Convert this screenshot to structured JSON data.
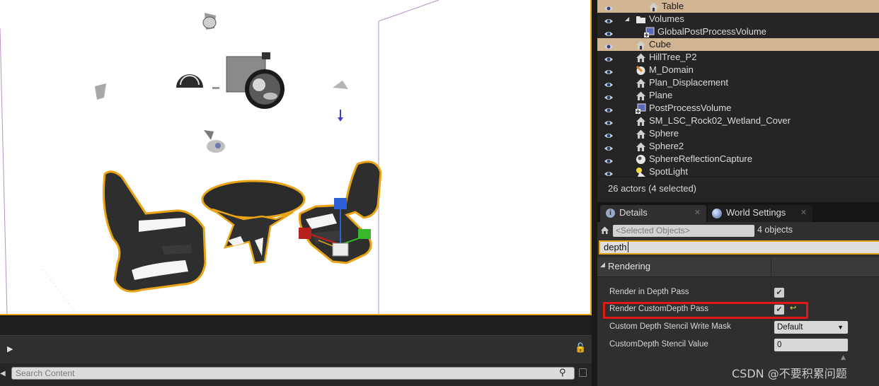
{
  "outliner": {
    "rows": [
      {
        "label": "Table",
        "icon": "house-icon",
        "selected": true
      },
      {
        "label": "Volumes",
        "icon": "folder-icon",
        "selected": false,
        "expander": true
      },
      {
        "label": "GlobalPostProcessVolume",
        "icon": "postprocess-volume-icon",
        "selected": false
      },
      {
        "label": "Cube",
        "icon": "house-icon",
        "selected": true
      },
      {
        "label": "HillTree_P2",
        "icon": "house-icon",
        "selected": false
      },
      {
        "label": "M_Domain",
        "icon": "material-icon",
        "selected": false
      },
      {
        "label": "Plan_Displacement",
        "icon": "house-icon",
        "selected": false
      },
      {
        "label": "Plane",
        "icon": "house-icon",
        "selected": false
      },
      {
        "label": "PostProcessVolume",
        "icon": "postprocess-volume-icon",
        "selected": false
      },
      {
        "label": "SM_LSC_Rock02_Wetland_Cover",
        "icon": "house-icon",
        "selected": false
      },
      {
        "label": "Sphere",
        "icon": "house-icon",
        "selected": false
      },
      {
        "label": "Sphere2",
        "icon": "house-icon",
        "selected": false
      },
      {
        "label": "SphereReflectionCapture",
        "icon": "reflection-capture-icon",
        "selected": false
      },
      {
        "label": "SpotLight",
        "icon": "spotlight-icon",
        "selected": false
      }
    ],
    "footer": "26 actors (4 selected)"
  },
  "tabs": {
    "details": "Details",
    "world_settings": "World Settings"
  },
  "details": {
    "selected_placeholder": "<Selected Objects>",
    "object_count": "4 objects",
    "search_value": "depth",
    "category": "Rendering",
    "properties": {
      "render_in_depth_pass": {
        "label": "Render in Depth Pass",
        "checked": true
      },
      "render_customdepth_pass": {
        "label": "Render CustomDepth Pass",
        "checked": true
      },
      "stencil_write_mask": {
        "label": "Custom Depth Stencil Write Mask",
        "value": "Default"
      },
      "stencil_value": {
        "label": "CustomDepth Stencil Value",
        "value": "0"
      }
    }
  },
  "content_browser": {
    "search_placeholder": "Search Content"
  },
  "watermark": "CSDN @不要积累问题",
  "colors": {
    "selection_border": "#e8a414",
    "row_selected": "#d2b694",
    "highlight_box": "#e01818"
  }
}
